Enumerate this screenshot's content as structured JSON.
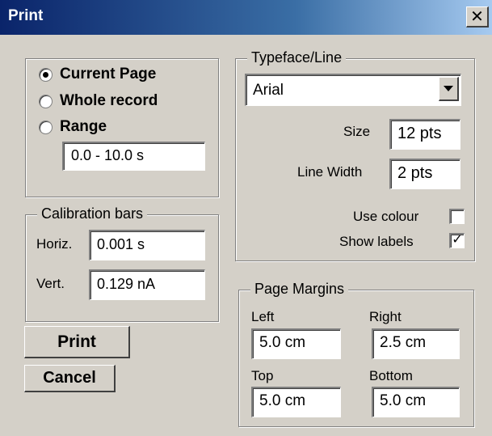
{
  "window": {
    "title": "Print",
    "close_glyph": "✕"
  },
  "page_range": {
    "options": [
      {
        "label": "Current Page",
        "selected": true
      },
      {
        "label": "Whole record",
        "selected": false
      },
      {
        "label": "Range",
        "selected": false
      }
    ],
    "range_value": "0.0 - 10.0 s"
  },
  "calibration": {
    "title": "Calibration bars",
    "horiz_label": "Horiz.",
    "horiz_value": "0.001 s",
    "vert_label": "Vert.",
    "vert_value": "0.129 nA"
  },
  "buttons": {
    "print": "Print",
    "cancel": "Cancel"
  },
  "typeface": {
    "title": "Typeface/Line",
    "font_value": "Arial",
    "size_label": "Size",
    "size_value": "12  pts",
    "line_width_label": "Line Width",
    "line_width_value": "2  pts",
    "use_colour_label": "Use colour",
    "use_colour_checked": false,
    "show_labels_label": "Show labels",
    "show_labels_checked": true,
    "check_glyph": "✓"
  },
  "margins": {
    "title": "Page Margins",
    "left_label": "Left",
    "left_value": "5.0 cm",
    "right_label": "Right",
    "right_value": "2.5 cm",
    "top_label": "Top",
    "top_value": "5.0 cm",
    "bottom_label": "Bottom",
    "bottom_value": "5.0 cm"
  }
}
